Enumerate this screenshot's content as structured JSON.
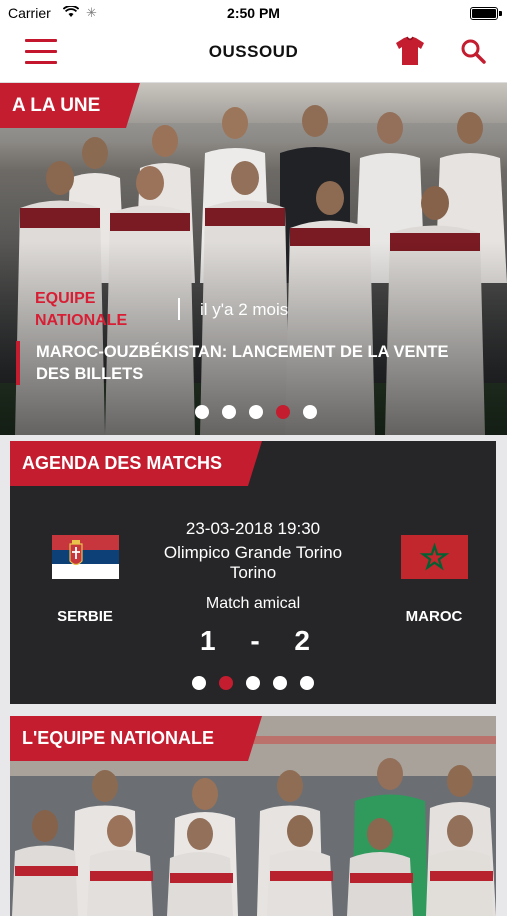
{
  "status_bar": {
    "carrier": "Carrier",
    "time": "2:50 PM"
  },
  "nav": {
    "title": "OUSSOUD",
    "menu_icon": "hamburger-icon",
    "jersey_icon": "jersey-icon",
    "search_icon": "search-icon"
  },
  "hero": {
    "tag": "A LA UNE",
    "category": "EQUIPE NATIONALE",
    "time_ago": "il y'a 2 mois",
    "headline": "MAROC-OUZBÉKISTAN: LANCEMENT DE LA VENTE DES BILLETS",
    "dots_total": 5,
    "dots_active_index": 3
  },
  "agenda": {
    "tag": "AGENDA DES MATCHS",
    "datetime": "23-03-2018 19:30",
    "stadium": "Olimpico Grande Torino",
    "city": "Torino",
    "match_type": "Match amical",
    "home_team": "SERBIE",
    "away_team": "MAROC",
    "home_score": "1",
    "away_score": "2",
    "score_separator": "-",
    "dots_total": 5,
    "dots_active_index": 1
  },
  "equipe": {
    "tag": "L'EQUIPE NATIONALE"
  },
  "colors": {
    "accent": "#c41d30",
    "card_dark": "#262628",
    "background": "#e8e8ea"
  }
}
